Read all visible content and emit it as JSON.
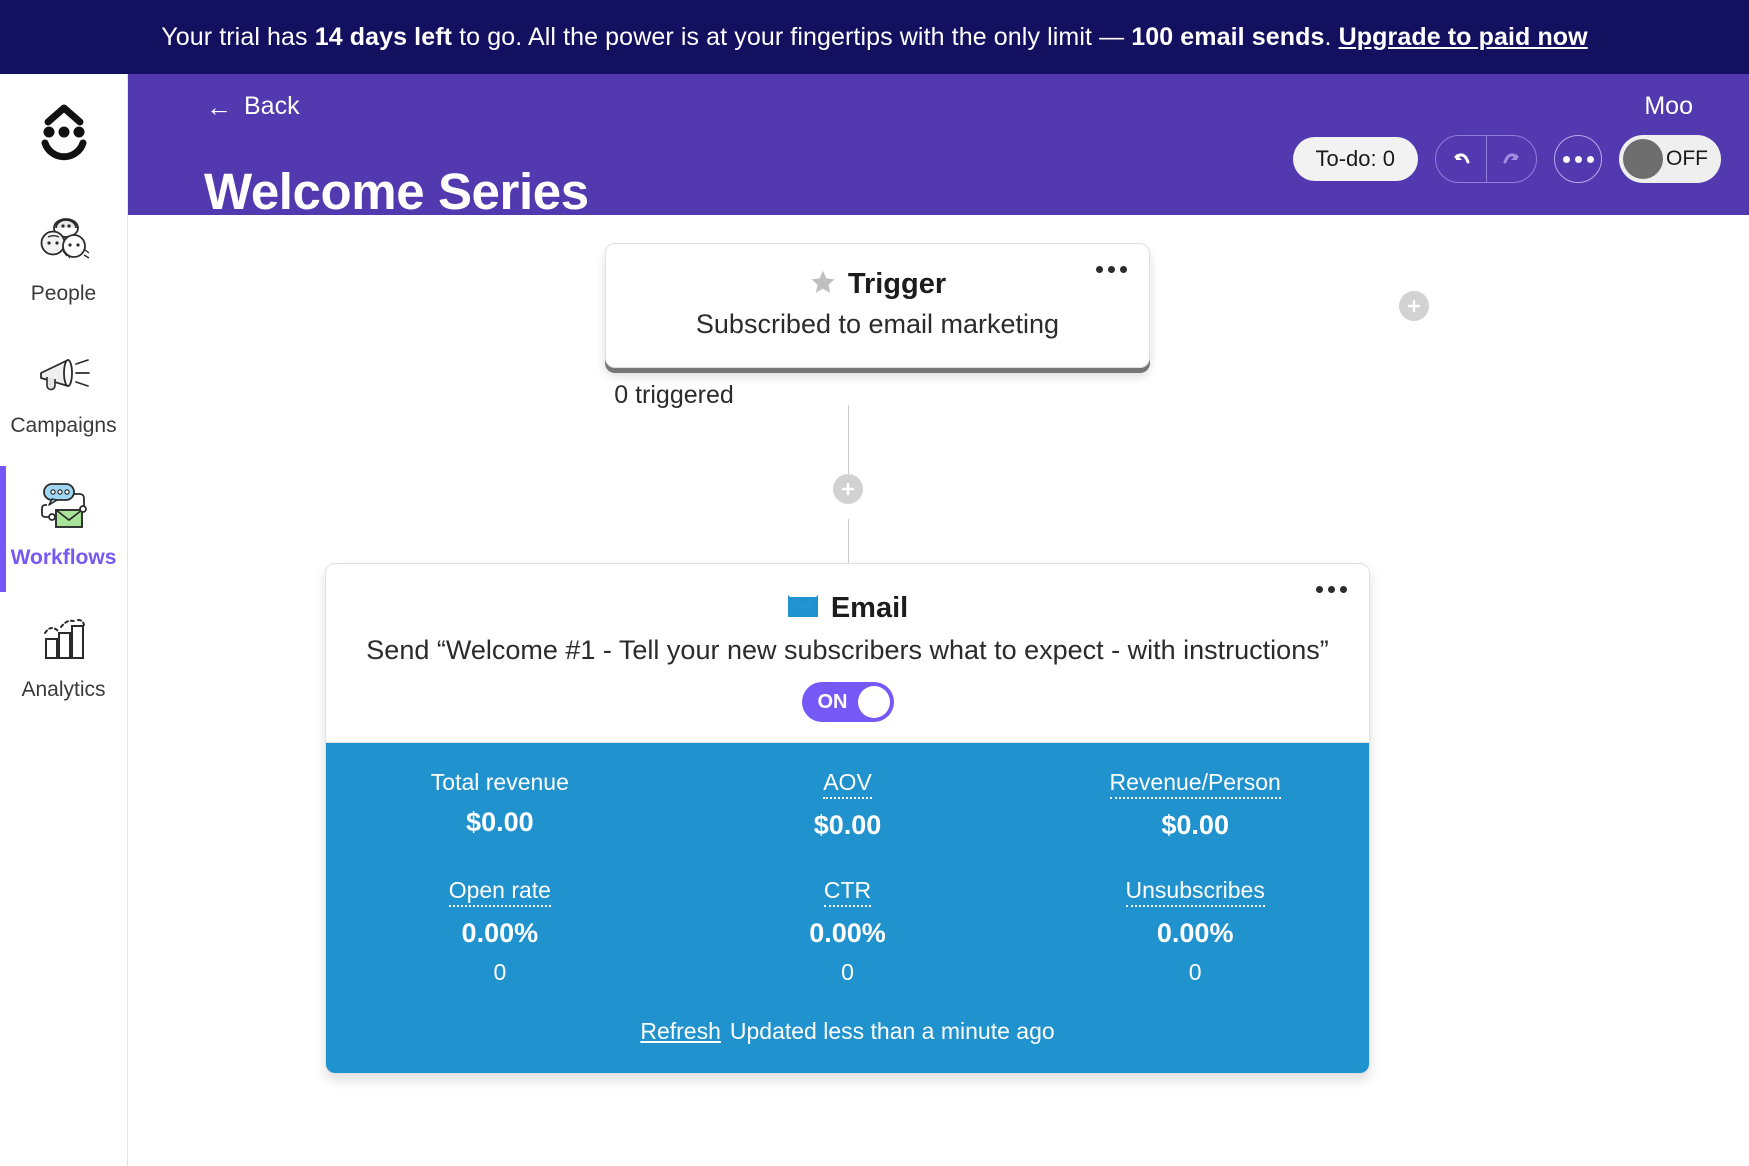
{
  "banner": {
    "text_part1": "Your trial has ",
    "days_left": "14 days left",
    "text_part2": " to go. All the power is at your fingertips with the only limit — ",
    "limit": "100 email sends",
    "text_part3": ". ",
    "cta": "Upgrade to paid now"
  },
  "sidebar": {
    "logo_name": "smiley-logo",
    "items": [
      {
        "label": "People",
        "icon": "people-icon",
        "active": false
      },
      {
        "label": "Campaigns",
        "icon": "megaphone-icon",
        "active": false
      },
      {
        "label": "Workflows",
        "icon": "workflow-chat-email-icon",
        "active": true
      },
      {
        "label": "Analytics",
        "icon": "bar-chart-icon",
        "active": false
      }
    ]
  },
  "header": {
    "back_label": "Back",
    "title": "Welcome Series",
    "user": "Moo",
    "todo_label": "To-do: 0",
    "undo_label": "Undo",
    "redo_label": "Redo",
    "more_label": "More options",
    "toggle_state": "OFF",
    "accent_purple": "#5239b0"
  },
  "canvas": {
    "trigger": {
      "title": "Trigger",
      "icon": "star-icon",
      "subtitle": "Subscribed to email marketing",
      "count_label": "0 triggered"
    },
    "add_buttons": [
      {
        "name": "add-step-branch-button"
      },
      {
        "name": "add-step-inline-button"
      }
    ],
    "email": {
      "title": "Email",
      "icon": "envelope-icon",
      "subtitle": "Send “Welcome #1 - Tell your new subscribers what to expect - with instructions”",
      "toggle_state": "ON",
      "accent_blue": "#2092ce",
      "stats": [
        {
          "label": "Total revenue",
          "value": "$0.00",
          "extra": "",
          "underlined": false
        },
        {
          "label": "AOV",
          "value": "$0.00",
          "extra": "",
          "underlined": true
        },
        {
          "label": "Revenue/Person",
          "value": "$0.00",
          "extra": "",
          "underlined": true
        },
        {
          "label": "Open rate",
          "value": "0.00%",
          "extra": "0",
          "underlined": true
        },
        {
          "label": "CTR",
          "value": "0.00%",
          "extra": "0",
          "underlined": true
        },
        {
          "label": "Unsubscribes",
          "value": "0.00%",
          "extra": "0",
          "underlined": true
        }
      ],
      "refresh_label": "Refresh",
      "updated_label": "Updated less than a minute ago"
    }
  }
}
